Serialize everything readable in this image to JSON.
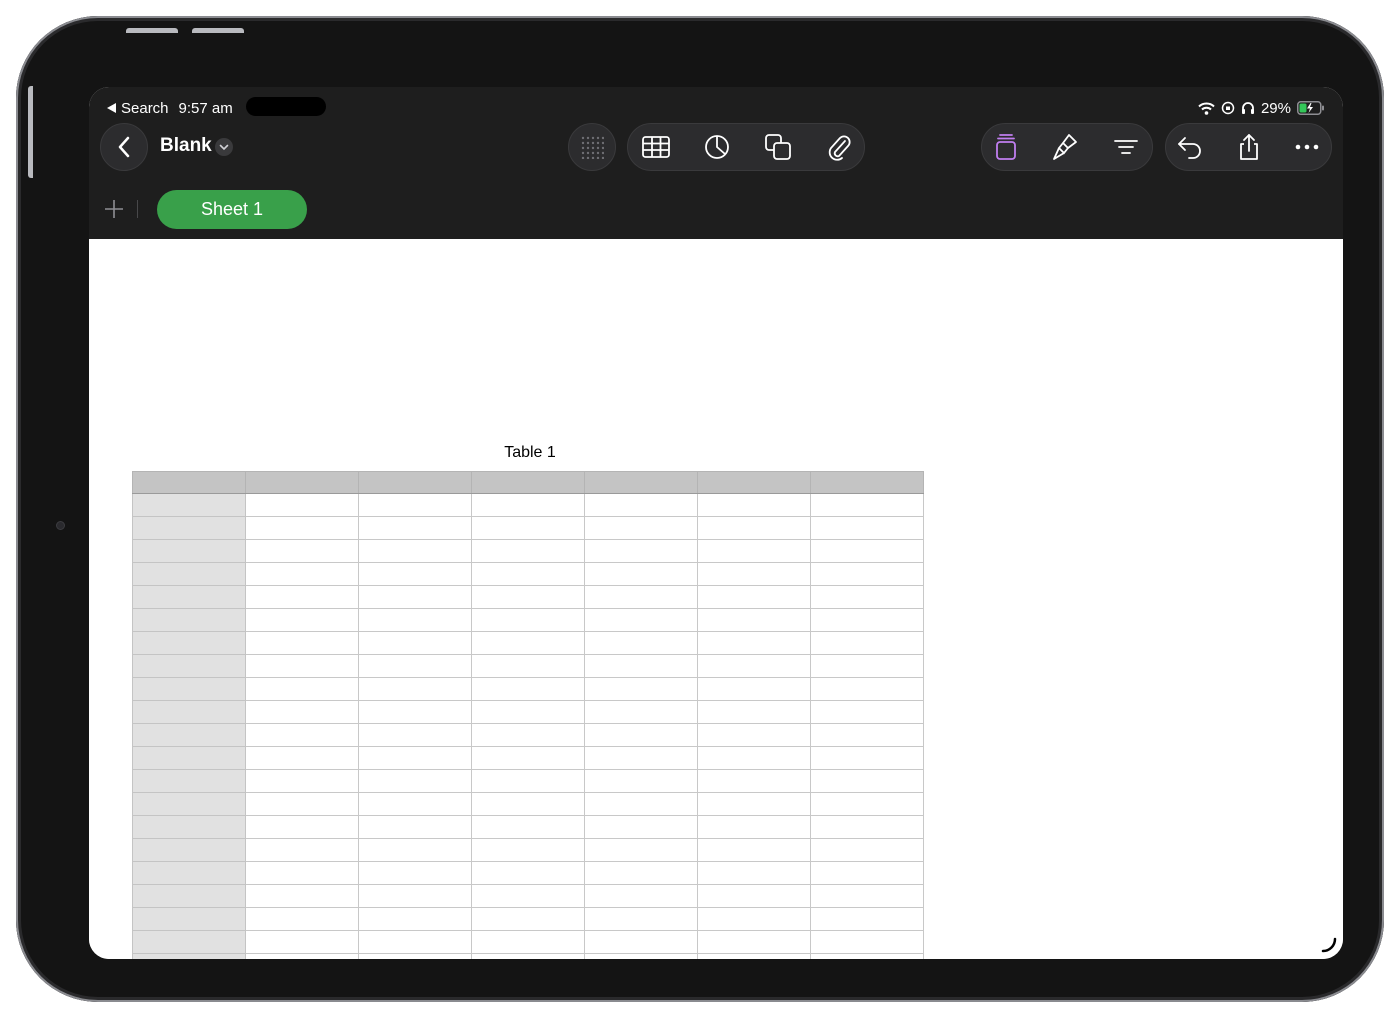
{
  "status_bar": {
    "back_app": "Search",
    "time": "9:57 am",
    "battery": "29%"
  },
  "toolbar": {
    "document_title": "Blank"
  },
  "sheets": {
    "active_tab": "Sheet 1"
  },
  "table": {
    "title": "Table 1",
    "columns": 7,
    "body_rows": 21
  },
  "colors": {
    "accent_green": "#39a04a",
    "format_purple": "#c07ef0",
    "toolbar_bg": "#1e1e1e",
    "header_gray": "#c4c4c4",
    "row_header_gray": "#e1e1e1"
  },
  "icons": [
    "back-chevron-icon",
    "dropdown-chevron-icon",
    "keypad-grid-icon",
    "table-icon",
    "chart-icon",
    "shapes-icon",
    "attachment-icon",
    "format-icon",
    "brush-icon",
    "organize-icon",
    "undo-icon",
    "share-icon",
    "more-icon",
    "add-sheet-icon",
    "wifi-icon",
    "headphones-icon",
    "battery-icon"
  ]
}
